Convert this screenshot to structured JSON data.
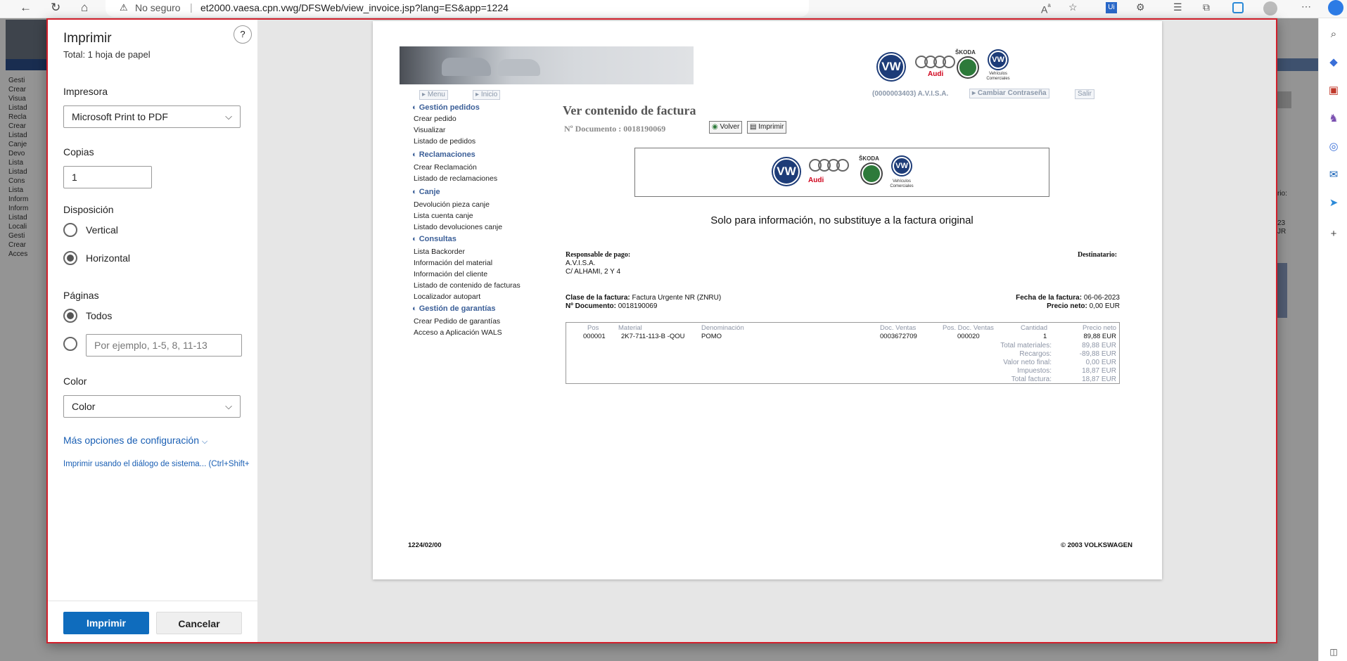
{
  "browser": {
    "security_label": "No seguro",
    "url": "et2000.vaesa.cpn.vwg/DFSWeb/view_invoice.jsp?lang=ES&app=1224"
  },
  "background_menu": {
    "items": [
      "Gesti",
      "Crear",
      "Visua",
      "Listad",
      "Recla",
      "Crear",
      "Listad",
      "Canje",
      "Devo",
      "Lista",
      "Listad",
      "Cons",
      "Lista",
      "Inform",
      "Inform",
      "Listad",
      "Locali",
      "Gesti",
      "Crear",
      "Acces"
    ],
    "right_texts": [
      "rio:",
      "23",
      "JR"
    ]
  },
  "print": {
    "title": "Imprimir",
    "subtitle": "Total: 1 hoja de papel",
    "help": "?",
    "printer_label": "Impresora",
    "printer_value": "Microsoft Print to PDF",
    "copies_label": "Copias",
    "copies_value": "1",
    "layout_label": "Disposición",
    "layout_options": [
      "Vertical",
      "Horizontal"
    ],
    "layout_selected": "Horizontal",
    "pages_label": "Páginas",
    "pages_all": "Todos",
    "pages_placeholder": "Por ejemplo, 1-5, 8, 11-13",
    "color_label": "Color",
    "color_value": "Color",
    "more_options": "Más opciones de configuración",
    "system_dialog": "Imprimir usando el diálogo de sistema... (Ctrl+Shift+",
    "print_button": "Imprimir",
    "cancel_button": "Cancelar"
  },
  "preview": {
    "nav": {
      "menu": "Menu",
      "inicio": "Inicio",
      "user": "(0000003403)  A.V.I.S.A.",
      "change_pw": "Cambiar Contraseña",
      "exit": "Salir"
    },
    "brands": {
      "audi": "Audi",
      "skoda": "ŠKODA",
      "vwc": "Vehículos Comerciales"
    },
    "menu": [
      {
        "heading": "Gestión pedidos",
        "items": [
          "Crear pedido",
          "Visualizar",
          "Listado de pedidos"
        ]
      },
      {
        "heading": "Reclamaciones",
        "items": [
          "Crear Reclamación",
          "Listado de reclamaciones"
        ]
      },
      {
        "heading": "Canje",
        "items": [
          "Devolución pieza canje",
          "Lista cuenta canje",
          "Listado devoluciones canje"
        ]
      },
      {
        "heading": "Consultas",
        "items": [
          "Lista Backorder",
          "Información del material",
          "Información del cliente",
          "Listado de contenido de facturas",
          "Localizador autopart"
        ]
      },
      {
        "heading": "Gestión de garantías",
        "items": [
          "Crear Pedido de garantías",
          "Acceso a Aplicación WALS"
        ]
      }
    ],
    "heading": "Ver contenido de factura",
    "doc_number_line": "Nº Documento : 0018190069",
    "btn_back": "Volver",
    "btn_print": "Imprimir",
    "info_notice": "Solo para información, no substituye a la factura original",
    "payer_label": "Responsable de pago",
    "payer_lines": [
      "A.V.I.S.A.",
      "C/ ALHAMI, 2 Y 4"
    ],
    "recipient_label": "Destinatario",
    "invoice_class_label": "Clase de la factura:",
    "invoice_class_value": "Factura Urgente NR (ZNRU)",
    "doc_label": "Nº Documento:",
    "doc_value": "0018190069",
    "invoice_date_label": "Fecha de la factura:",
    "invoice_date_value": "06-06-2023",
    "net_price_label": "Precio neto:",
    "net_price_value": "0,00 EUR",
    "table": {
      "headers": [
        "Pos",
        "Material",
        "Denominación",
        "Doc. Ventas",
        "Pos. Doc. Ventas",
        "Cantidad",
        "Precio neto"
      ],
      "rows": [
        [
          "000001",
          "2K7-711-113-B -QOU",
          "POMO",
          "0003672709",
          "000020",
          "1",
          "89,88 EUR"
        ]
      ]
    },
    "totals": [
      {
        "label": "Total materiales:",
        "value": "89,88 EUR"
      },
      {
        "label": "Recargos:",
        "value": "-89,88 EUR"
      },
      {
        "label": "Valor neto final:",
        "value": "0,00 EUR"
      },
      {
        "label": "Impuestos:",
        "value": "18,87 EUR"
      },
      {
        "label": "Total factura:",
        "value": "18,87 EUR"
      }
    ],
    "footer_left": "1224/02/00",
    "footer_right": "© 2003 VOLKSWAGEN"
  }
}
